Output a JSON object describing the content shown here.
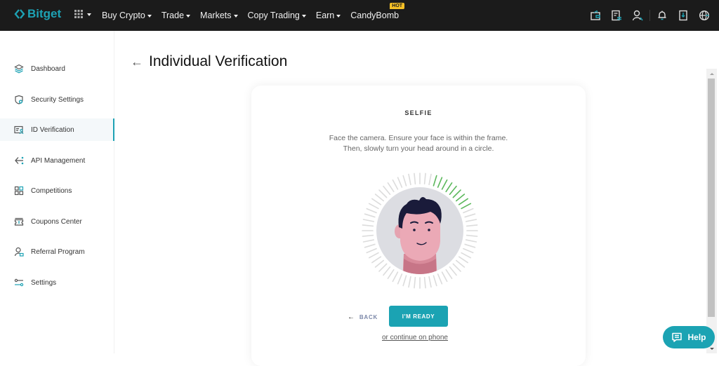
{
  "brand": {
    "name": "Bitget",
    "accent": "#1da2b4"
  },
  "topnav": {
    "items": [
      {
        "label": "Buy Crypto",
        "dropdown": true
      },
      {
        "label": "Trade",
        "dropdown": true
      },
      {
        "label": "Markets",
        "dropdown": true
      },
      {
        "label": "Copy Trading",
        "dropdown": true
      },
      {
        "label": "Earn",
        "dropdown": true
      },
      {
        "label": "CandyBomb",
        "dropdown": false,
        "badge": "HOT"
      }
    ],
    "right_icons": [
      "wallet-icon",
      "orders-icon",
      "user-icon",
      "bell-icon",
      "download-icon",
      "globe-icon"
    ]
  },
  "sidebar": {
    "active_index": 2,
    "items": [
      {
        "label": "Dashboard",
        "icon": "dashboard-layers-icon"
      },
      {
        "label": "Security Settings",
        "icon": "shield-icon"
      },
      {
        "label": "ID Verification",
        "icon": "id-card-icon"
      },
      {
        "label": "API Management",
        "icon": "api-icon"
      },
      {
        "label": "Competitions",
        "icon": "grid-icon"
      },
      {
        "label": "Coupons Center",
        "icon": "coupon-icon"
      },
      {
        "label": "Referral Program",
        "icon": "referral-user-icon"
      },
      {
        "label": "Settings",
        "icon": "sliders-icon"
      }
    ]
  },
  "page": {
    "title": "Individual Verification",
    "back_icon": "arrow-left-icon"
  },
  "card": {
    "title": "SELFIE",
    "description_line1": "Face the camera. Ensure your face is within the frame.",
    "description_line2": "Then, slowly turn your head around in a circle.",
    "back_label": "BACK",
    "ready_label": "I'M READY",
    "phone_link": "or continue on phone",
    "progress_ticks_done": 9,
    "progress_ticks_total": 64,
    "colors": {
      "tick_done": "#5cb85c",
      "tick_pending": "#dcdcdc",
      "button": "#1ba3b3"
    }
  },
  "help": {
    "label": "Help"
  }
}
